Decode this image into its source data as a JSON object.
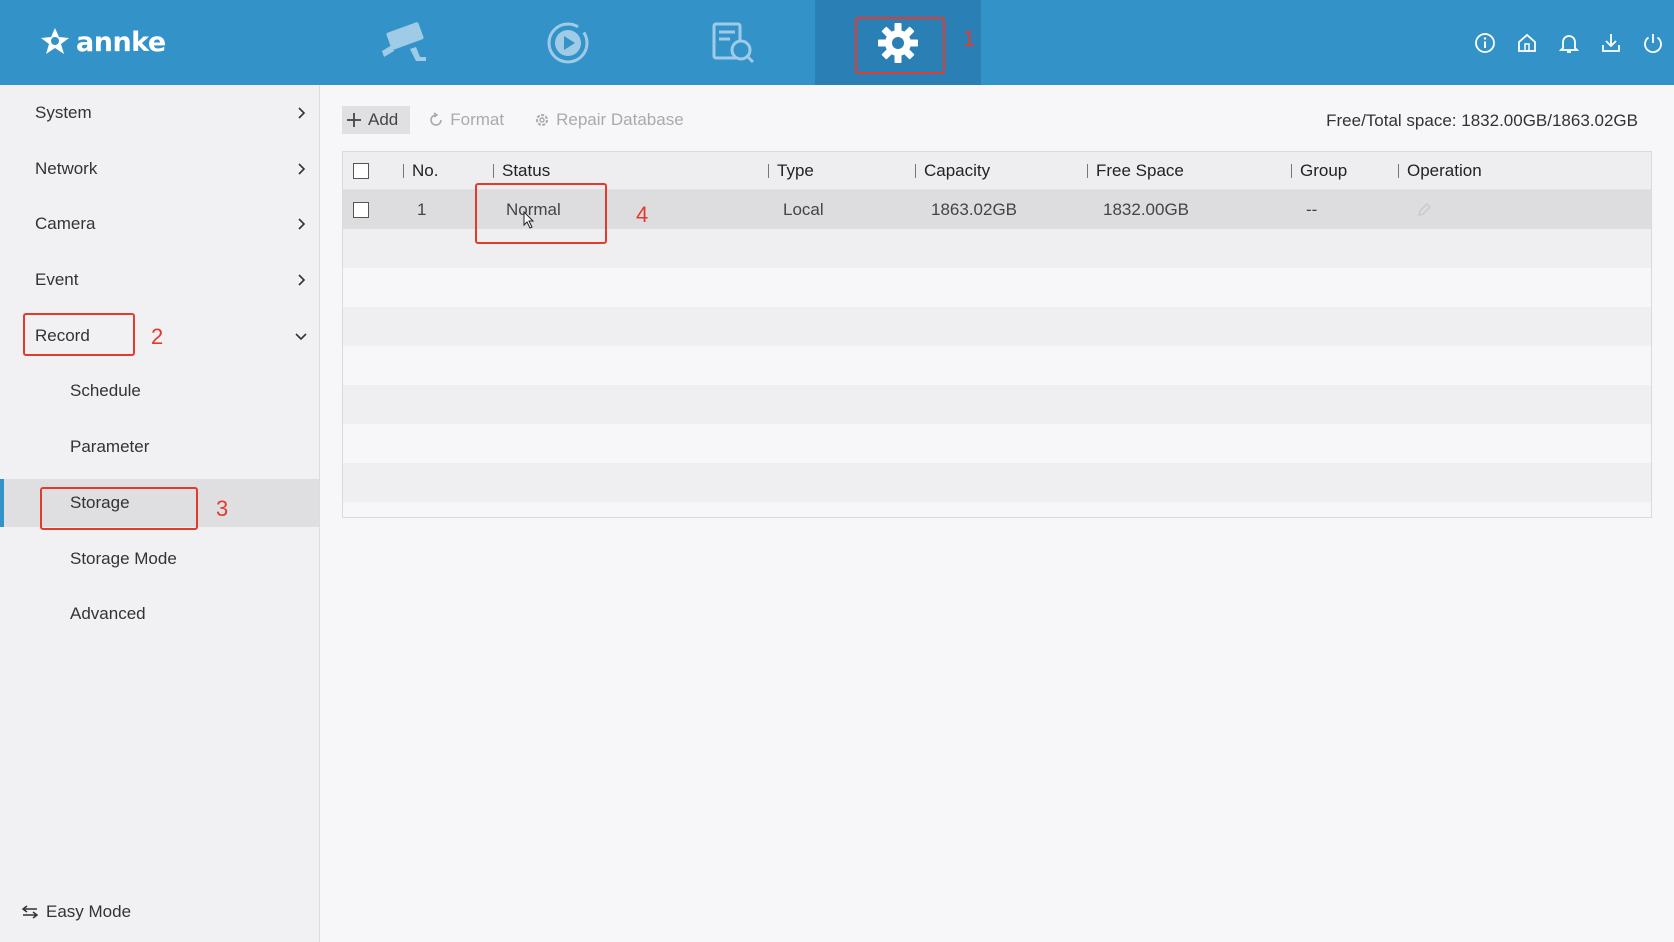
{
  "app": {
    "brand": "annke"
  },
  "topnav": {
    "tabs": [
      {
        "name": "live-view",
        "icon": "camera-icon"
      },
      {
        "name": "playback",
        "icon": "playback-icon"
      },
      {
        "name": "search",
        "icon": "search-doc-icon"
      },
      {
        "name": "configuration",
        "icon": "gear-icon",
        "active": true
      }
    ],
    "right_icons": [
      "info-icon",
      "home-icon",
      "bell-icon",
      "download-icon",
      "power-icon"
    ]
  },
  "sidebar": {
    "items": [
      {
        "label": "System",
        "expandable": true
      },
      {
        "label": "Network",
        "expandable": true
      },
      {
        "label": "Camera",
        "expandable": true
      },
      {
        "label": "Event",
        "expandable": true
      },
      {
        "label": "Record",
        "expanded": true
      }
    ],
    "record_sub": [
      {
        "label": "Schedule"
      },
      {
        "label": "Parameter"
      },
      {
        "label": "Storage",
        "selected": true
      },
      {
        "label": "Storage Mode"
      },
      {
        "label": "Advanced"
      }
    ],
    "easy_mode_label": "Easy Mode"
  },
  "toolbar": {
    "add_label": "Add",
    "format_label": "Format",
    "repair_label": "Repair Database"
  },
  "space_info": "Free/Total space: 1832.00GB/1863.02GB",
  "table": {
    "headers": [
      "No.",
      "Status",
      "Type",
      "Capacity",
      "Free Space",
      "Group",
      "Operation"
    ],
    "rows": [
      {
        "no": "1",
        "status": "Normal",
        "type": "Local",
        "capacity": "1863.02GB",
        "free_space": "1832.00GB",
        "group": "--"
      }
    ]
  },
  "annotations": [
    "1",
    "2",
    "3",
    "4"
  ],
  "colors": {
    "topbar": "#3393c8",
    "active_tab": "#2a7fb4",
    "annotation": "#e23b2e"
  }
}
